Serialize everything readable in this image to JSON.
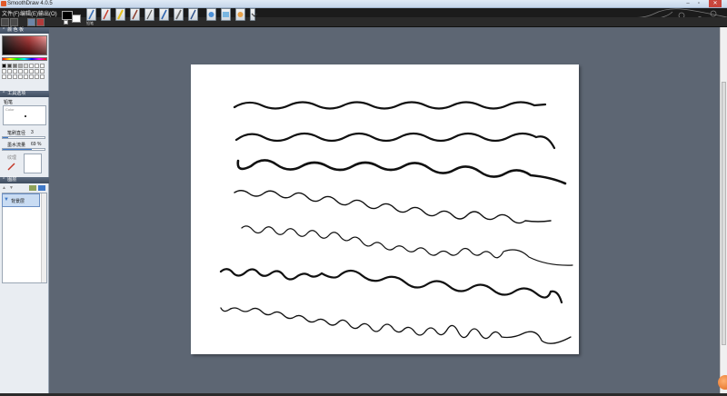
{
  "window": {
    "title": "SmoothDraw 4.0.5",
    "minimize": "–",
    "maximize": "▫",
    "close": "✕"
  },
  "menu": {
    "file": "文件(F)",
    "edit": "编辑(E)",
    "output": "输出(O)"
  },
  "toolbar": {
    "tool_caption": "铅笔"
  },
  "panels": {
    "color_title": "颜 色 板",
    "tool_title": "工具选项",
    "brush_name": "铅笔",
    "preview_caption": "Color",
    "brush_size_label": "笔刷直径",
    "brush_size_value": "3",
    "opacity_label": "墨水流量",
    "opacity_value": "69 %",
    "brush_size_fraction": 0.12,
    "opacity_fraction": 0.69,
    "texture_label": "纹理",
    "layers_title": "图层",
    "layer_name": "背景层"
  },
  "colors": {
    "primary": "#000000",
    "secondary": "#ffffff",
    "accent": "#3f79c8",
    "workspace": "#5d6673"
  },
  "icons": [
    "pencil-icon",
    "brush-icon",
    "marker-icon",
    "airbrush-icon",
    "pen-icon",
    "smudge-icon",
    "eraser-icon",
    "fill-icon",
    "stamp-icon"
  ]
}
